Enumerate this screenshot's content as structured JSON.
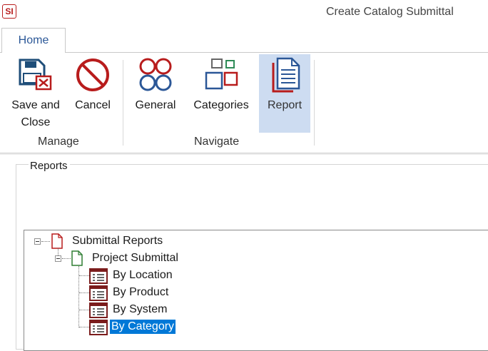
{
  "app": {
    "logo_text": "SI",
    "title": "Create Catalog Submittal"
  },
  "tabs": [
    {
      "label": "Home",
      "active": true
    }
  ],
  "ribbon": {
    "groups": [
      {
        "label": "Manage",
        "buttons": [
          {
            "label_line1": "Save and",
            "label_line2": "Close",
            "icon": "save-close-icon"
          },
          {
            "label": "Cancel",
            "icon": "cancel-icon"
          }
        ]
      },
      {
        "label": "Navigate",
        "buttons": [
          {
            "label": "General",
            "icon": "general-icon"
          },
          {
            "label": "Categories",
            "icon": "categories-icon"
          },
          {
            "label": "Report",
            "icon": "report-icon",
            "selected": true
          }
        ]
      }
    ]
  },
  "reports_panel": {
    "legend": "Reports",
    "tree": {
      "root": {
        "label": "Submittal Reports",
        "expanded": true
      },
      "child": {
        "label": "Project Submittal",
        "expanded": true
      },
      "items": [
        {
          "label": "By Location",
          "selected": false
        },
        {
          "label": "By Product",
          "selected": false
        },
        {
          "label": "By System",
          "selected": false
        },
        {
          "label": "By Category",
          "selected": true
        }
      ]
    }
  },
  "colors": {
    "accent": "#2b5797",
    "brand_red": "#b81c1c",
    "selection": "#0078d7",
    "ribbon_highlight": "#cddcf1"
  }
}
